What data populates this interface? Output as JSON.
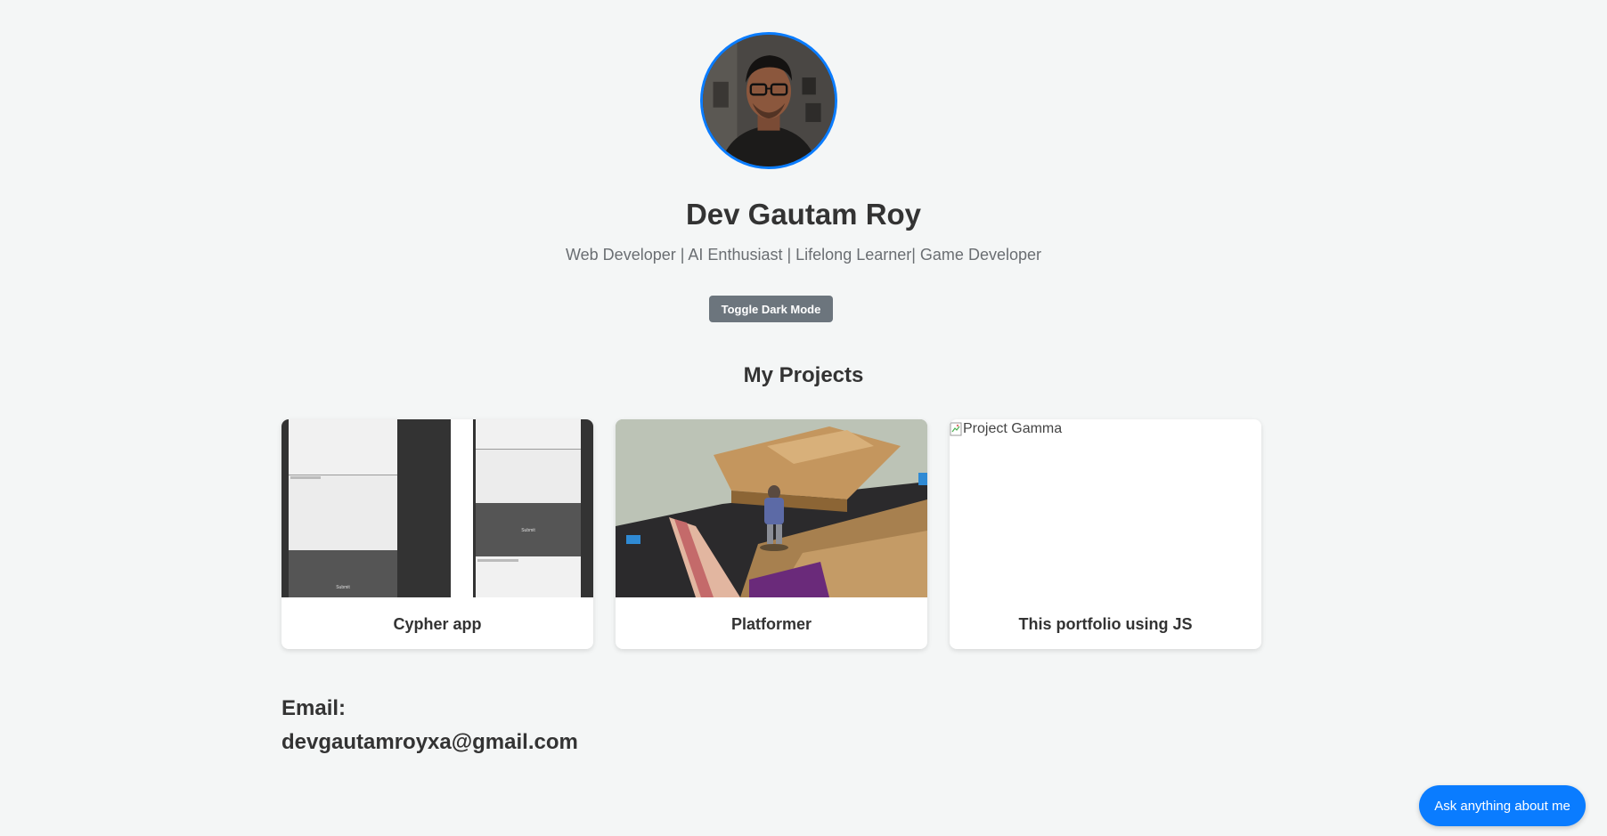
{
  "profile": {
    "name": "Dev Gautam Roy",
    "tagline": "Web Developer | AI Enthusiast | Lifelong Learner| Game Developer",
    "avatar_alt": "profile photo"
  },
  "toggle_dark_mode_label": "Toggle Dark Mode",
  "projects": {
    "heading": "My Projects",
    "items": [
      {
        "title": "Cypher app",
        "thumb_texts": [
          "Submit",
          "Submit"
        ]
      },
      {
        "title": "Platformer"
      },
      {
        "title": "This portfolio using JS",
        "broken_image_alt": "Project Gamma"
      }
    ]
  },
  "contact": {
    "email_label": "Email:",
    "email": "devgautamroyxa@gmail.com"
  },
  "chat_button_label": "Ask anything about me",
  "colors": {
    "accent": "#0a7cff",
    "toggle_bg": "#6c757d",
    "page_bg": "#f4f6f6",
    "text": "#333333"
  }
}
